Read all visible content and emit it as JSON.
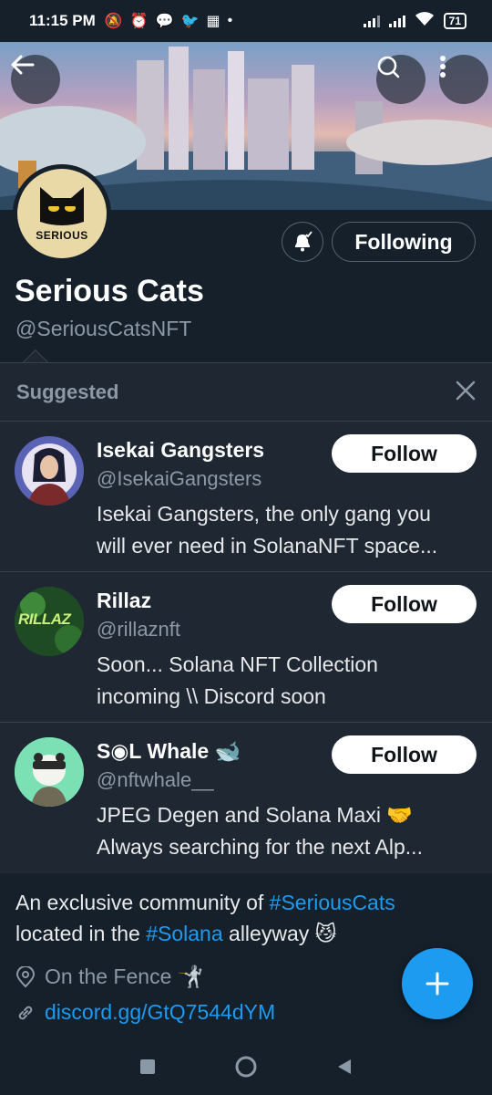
{
  "status_bar": {
    "time": "11:15 PM",
    "battery": "71"
  },
  "profile": {
    "avatar_text": "SERIOUS",
    "display_name": "Serious Cats",
    "handle": "@SeriousCatsNFT",
    "following_label": "Following"
  },
  "suggested": {
    "title": "Suggested",
    "items": [
      {
        "name": "Isekai Gangsters",
        "handle": "@IsekaiGangsters",
        "bio_line1": "Isekai Gangsters, the only gang you",
        "bio_line2": "will ever need in SolanaNFT space...",
        "follow_label": "Follow"
      },
      {
        "name": "Rillaz",
        "handle": "@rillaznft",
        "avatar_text": "RILLAZ",
        "bio_line1": "Soon...  Solana NFT Collection",
        "bio_line2": "incoming \\\\ Discord soon",
        "follow_label": "Follow"
      },
      {
        "name": "S◉L Whale 🐋",
        "handle": "@nftwhale__",
        "bio_line1": "JPEG Degen and Solana Maxi 🤝",
        "bio_line2": "Always searching for the next Alp...",
        "follow_label": "Follow"
      }
    ]
  },
  "bio": {
    "part1": "An exclusive community of ",
    "hashtag1": "#SeriousCats",
    "part2": "located in the ",
    "hashtag2": "#Solana",
    "part3": " alleyway 😼"
  },
  "meta": {
    "location": "On the Fence 🤺",
    "link": "discord.gg/GtQ7544dYM"
  },
  "colors": {
    "background": "#15202b",
    "card": "#1e2732",
    "accent": "#1d9bf0",
    "muted": "#8b98a5"
  }
}
